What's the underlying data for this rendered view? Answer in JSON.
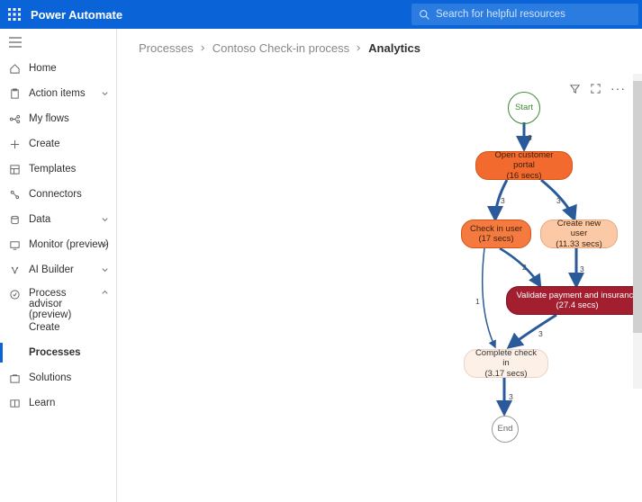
{
  "header": {
    "app_title": "Power Automate",
    "search_placeholder": "Search for helpful resources"
  },
  "sidebar": {
    "items": [
      {
        "label": "Home"
      },
      {
        "label": "Action items"
      },
      {
        "label": "My flows"
      },
      {
        "label": "Create"
      },
      {
        "label": "Templates"
      },
      {
        "label": "Connectors"
      },
      {
        "label": "Data"
      },
      {
        "label": "Monitor (preview)"
      },
      {
        "label": "AI Builder"
      },
      {
        "label": "Process advisor (preview)"
      },
      {
        "label": "Create"
      },
      {
        "label": "Processes"
      },
      {
        "label": "Solutions"
      },
      {
        "label": "Learn"
      }
    ]
  },
  "breadcrumb": {
    "a": "Processes",
    "b": "Contoso Check-in process",
    "c": "Analytics"
  },
  "nodes": {
    "start": "Start",
    "open_portal_t": "Open customer portal",
    "open_portal_s": "(16 secs)",
    "checkin_t": "Check in user",
    "checkin_s": "(17 secs)",
    "newuser_t": "Create new user",
    "newuser_s": "(11.33 secs)",
    "validate_t": "Validate payment and insurance",
    "validate_s": "(27.4 secs)",
    "complete_t": "Complete check in",
    "complete_s": "(3.17 secs)",
    "end": "End"
  },
  "edges": {
    "e1": "3",
    "e2": "3",
    "e3": "3",
    "e4": "2",
    "e5": "3",
    "e6": "1",
    "e7": "3",
    "e8": "3"
  }
}
